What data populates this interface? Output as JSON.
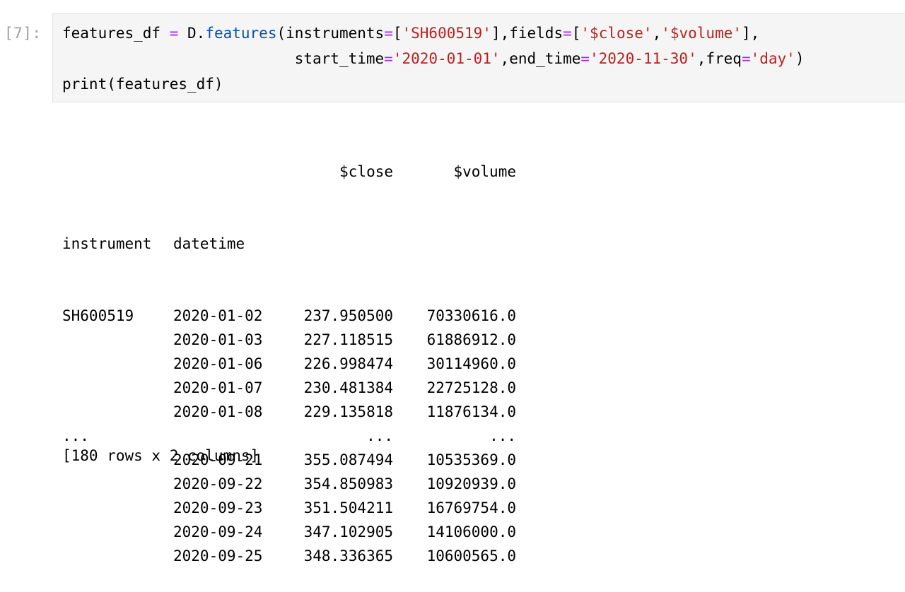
{
  "cell": {
    "prompt": "[7]:",
    "code": {
      "l1_var": "features_df",
      "l1_eq": " = ",
      "l1_obj": "D.",
      "l1_fn": "features",
      "l1_open": "(instruments",
      "l1_eq2": "=",
      "l1_br1": "[",
      "l1_s1": "'SH600519'",
      "l1_br2": "],fields",
      "l1_eq3": "=",
      "l1_br3": "[",
      "l1_s2": "'$close'",
      "l1_comma": ",",
      "l1_s3": "'$volume'",
      "l1_br4": "],",
      "l2_indent": "                          ",
      "l2_k1": "start_time",
      "l2_eq1": "=",
      "l2_s1": "'2020-01-01'",
      "l2_k2": ",end_time",
      "l2_eq2": "=",
      "l2_s2": "'2020-11-30'",
      "l2_k3": ",freq",
      "l2_eq3": "=",
      "l2_s3": "'day'",
      "l2_close": ")",
      "l3": "print(features_df)"
    }
  },
  "output": {
    "header": {
      "close": "$close",
      "volume": "$volume"
    },
    "index_header": {
      "instrument": "instrument",
      "datetime": "datetime"
    },
    "rows": [
      {
        "instrument": "SH600519",
        "datetime": "2020-01-02",
        "close": "237.950500",
        "volume": "70330616.0"
      },
      {
        "instrument": "",
        "datetime": "2020-01-03",
        "close": "227.118515",
        "volume": "61886912.0"
      },
      {
        "instrument": "",
        "datetime": "2020-01-06",
        "close": "226.998474",
        "volume": "30114960.0"
      },
      {
        "instrument": "",
        "datetime": "2020-01-07",
        "close": "230.481384",
        "volume": "22725128.0"
      },
      {
        "instrument": "",
        "datetime": "2020-01-08",
        "close": "229.135818",
        "volume": "11876134.0"
      },
      {
        "instrument": "...",
        "datetime": "",
        "close": "...",
        "volume": "..."
      },
      {
        "instrument": "",
        "datetime": "2020-09-21",
        "close": "355.087494",
        "volume": "10535369.0"
      },
      {
        "instrument": "",
        "datetime": "2020-09-22",
        "close": "354.850983",
        "volume": "10920939.0"
      },
      {
        "instrument": "",
        "datetime": "2020-09-23",
        "close": "351.504211",
        "volume": "16769754.0"
      },
      {
        "instrument": "",
        "datetime": "2020-09-24",
        "close": "347.102905",
        "volume": "14106000.0"
      },
      {
        "instrument": "",
        "datetime": "2020-09-25",
        "close": "348.336365",
        "volume": "10600565.0"
      }
    ],
    "summary": "[180 rows x 2 columns]"
  }
}
